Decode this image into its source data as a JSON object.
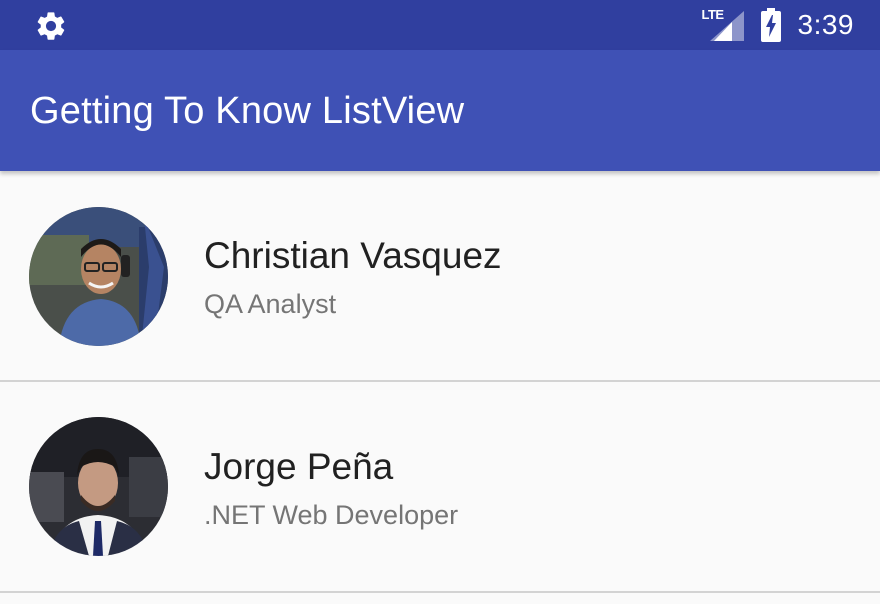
{
  "status_bar": {
    "network_label": "LTE",
    "time": "3:39",
    "icons": [
      "gear-icon",
      "signal-icon",
      "battery-charging-icon"
    ]
  },
  "app_bar": {
    "title": "Getting To Know ListView"
  },
  "list": {
    "items": [
      {
        "name": "Christian Vasquez",
        "role": "QA Analyst",
        "avatar": "avatar-photo"
      },
      {
        "name": "Jorge Peña",
        "role": ".NET Web Developer",
        "avatar": "avatar-photo"
      }
    ]
  },
  "colors": {
    "status_bar": "#303f9f",
    "app_bar": "#3f51b5",
    "background": "#fafafa",
    "primary_text": "#212121",
    "secondary_text": "#757575",
    "divider": "#d3d3d3"
  }
}
